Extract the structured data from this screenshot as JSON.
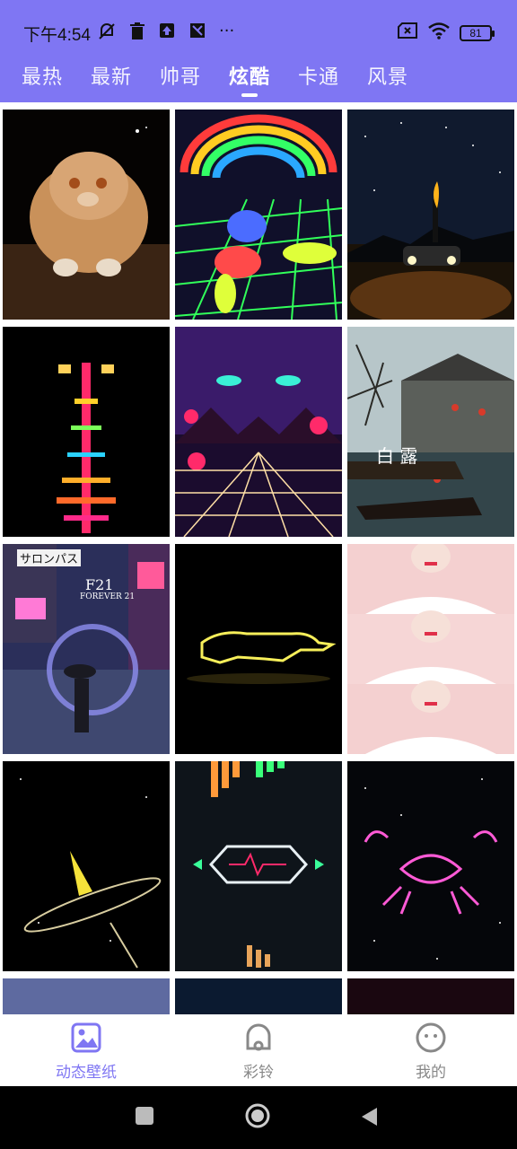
{
  "status_bar": {
    "time": "下午4:54",
    "icons": [
      "mute-icon",
      "trash-icon",
      "upload-icon",
      "vpn-icon",
      "more-icon"
    ],
    "more": "···",
    "battery": "81"
  },
  "tabs": [
    {
      "label": "最热"
    },
    {
      "label": "最新"
    },
    {
      "label": "帅哥"
    },
    {
      "label": "炫酷",
      "active": true
    },
    {
      "label": "卡通"
    },
    {
      "label": "风景"
    }
  ],
  "grid": {
    "overlay_texts": {
      "tile6_text": "白 露",
      "tile7_sign1": "サロンパス",
      "tile7_sign2": "F21",
      "tile7_sign3": "FOREVER 21"
    }
  },
  "bottom_nav": [
    {
      "label": "动态壁纸",
      "icon": "wallpaper-icon",
      "active": true
    },
    {
      "label": "彩铃",
      "icon": "bell-icon",
      "active": false
    },
    {
      "label": "我的",
      "icon": "smiley-icon",
      "active": false
    }
  ],
  "colors": {
    "accent": "#7f76f3",
    "nav_inactive": "#888888"
  }
}
